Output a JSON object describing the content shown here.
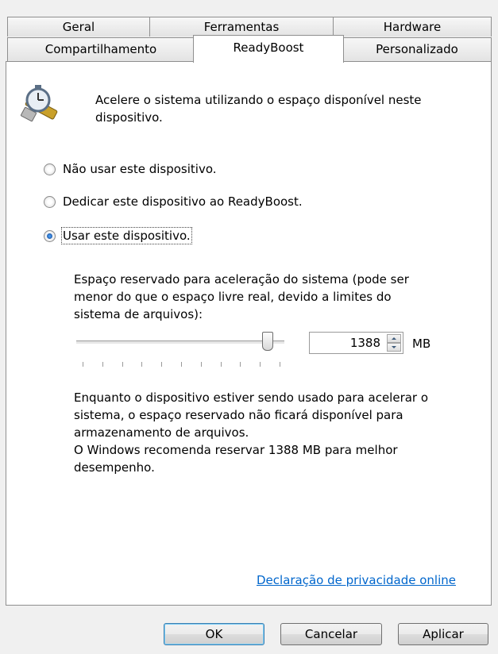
{
  "tabs": {
    "row1": [
      "Geral",
      "Ferramentas",
      "Hardware"
    ],
    "row2": [
      "Compartilhamento",
      "ReadyBoost",
      "Personalizado"
    ]
  },
  "header": {
    "icon": "stopwatch-usb-icon",
    "line1": "Acelere o sistema utilizando o espaço disponível neste",
    "line2": "dispositivo."
  },
  "options": [
    {
      "label": "Não usar este dispositivo.",
      "checked": false
    },
    {
      "label": "Dedicar este dispositivo ao ReadyBoost.",
      "checked": false
    },
    {
      "label": "Usar este dispositivo.",
      "checked": true
    }
  ],
  "reserved": {
    "line1": "Espaço reservado para aceleração do sistema (pode ser",
    "line2": "menor do que o espaço livre real, devido a limites do",
    "line3": "sistema de arquivos):",
    "value": "1388",
    "unit": "MB",
    "slider_fraction": 0.94
  },
  "info": {
    "line1": "Enquanto o dispositivo estiver sendo usado para acelerar o",
    "line2": "sistema, o espaço reservado não ficará disponível para",
    "line3": "armazenamento de arquivos.",
    "line4": "O Windows recomenda reservar 1388 MB para melhor",
    "line5": "desempenho."
  },
  "privacy_link": "Declaração de privacidade online",
  "buttons": {
    "ok": "OK",
    "cancel": "Cancelar",
    "apply": "Aplicar"
  },
  "colors": {
    "link": "#0066cc",
    "accent": "#3c7fb1"
  }
}
